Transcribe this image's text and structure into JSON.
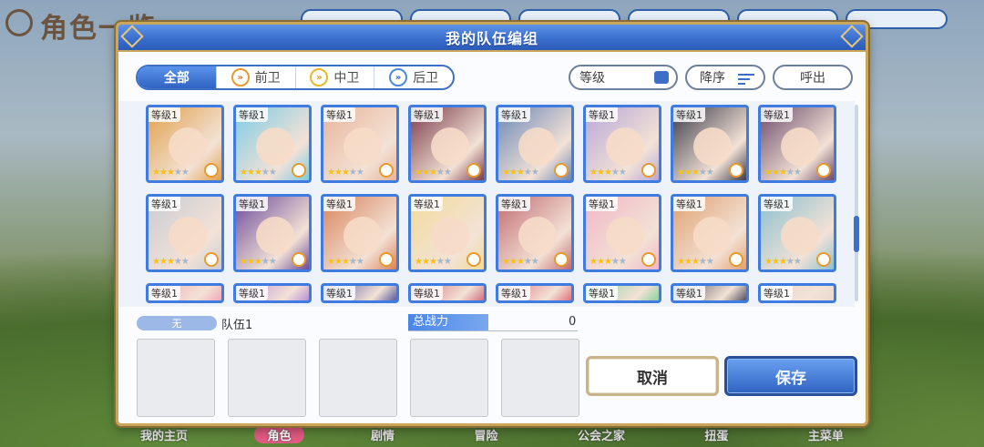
{
  "background": {
    "screen_title": "角色一览",
    "bottom_nav": [
      "我的主页",
      "角色",
      "剧情",
      "冒险",
      "公会之家",
      "扭蛋",
      "主菜单"
    ],
    "bottom_nav_active": 1
  },
  "modal": {
    "title": "我的队伍编组",
    "filter_tabs": [
      {
        "label": "全部",
        "icon": ""
      },
      {
        "label": "前卫",
        "icon": "front-guard-icon"
      },
      {
        "label": "中卫",
        "icon": "middle-guard-icon"
      },
      {
        "label": "后卫",
        "icon": "back-guard-icon"
      }
    ],
    "sort_label": "等级",
    "order_label": "降序",
    "call_label": "呼出",
    "characters": [
      {
        "level": "等级1",
        "stars": 3,
        "color": "#e0a04a"
      },
      {
        "level": "等级1",
        "stars": 3,
        "color": "#7ccbe6"
      },
      {
        "level": "等级1",
        "stars": 3,
        "color": "#e8b49a"
      },
      {
        "level": "等级1",
        "stars": 3,
        "color": "#7a3a4a"
      },
      {
        "level": "等级1",
        "stars": 3,
        "color": "#6a86b8"
      },
      {
        "level": "等级1",
        "stars": 3,
        "color": "#b7a6d8"
      },
      {
        "level": "等级1",
        "stars": 3,
        "color": "#3a3a4a"
      },
      {
        "level": "等级1",
        "stars": 3,
        "color": "#6b4a6a"
      },
      {
        "level": "等级1",
        "stars": 3,
        "color": "#c9cbd4"
      },
      {
        "level": "等级1",
        "stars": 3,
        "color": "#6a4a9a"
      },
      {
        "level": "等级1",
        "stars": 3,
        "color": "#d8825a"
      },
      {
        "level": "等级1",
        "stars": 3,
        "color": "#f0dc9a"
      },
      {
        "level": "等级1",
        "stars": 3,
        "color": "#c06a70"
      },
      {
        "level": "等级1",
        "stars": 3,
        "color": "#f0b6c6"
      },
      {
        "level": "等级1",
        "stars": 3,
        "color": "#e0a070"
      },
      {
        "level": "等级1",
        "stars": 3,
        "color": "#8ac0d0"
      },
      {
        "level": "等级1",
        "stars": 0,
        "color": "#f0a8b8"
      },
      {
        "level": "等级1",
        "stars": 0,
        "color": "#b890d8"
      },
      {
        "level": "等级1",
        "stars": 0,
        "color": "#5a5aa0"
      },
      {
        "level": "等级1",
        "stars": 0,
        "color": "#d07080"
      },
      {
        "level": "等级1",
        "stars": 0,
        "color": "#e07080"
      },
      {
        "level": "等级1",
        "stars": 0,
        "color": "#8ad0a0"
      },
      {
        "level": "等级1",
        "stars": 0,
        "color": "#505060"
      },
      {
        "level": "等级1",
        "stars": 0,
        "color": "#e8d8d0"
      }
    ],
    "team": {
      "tag": "无",
      "name": "队伍1",
      "power_label": "总战力",
      "power_value": "0"
    },
    "cancel_label": "取消",
    "save_label": "保存"
  }
}
